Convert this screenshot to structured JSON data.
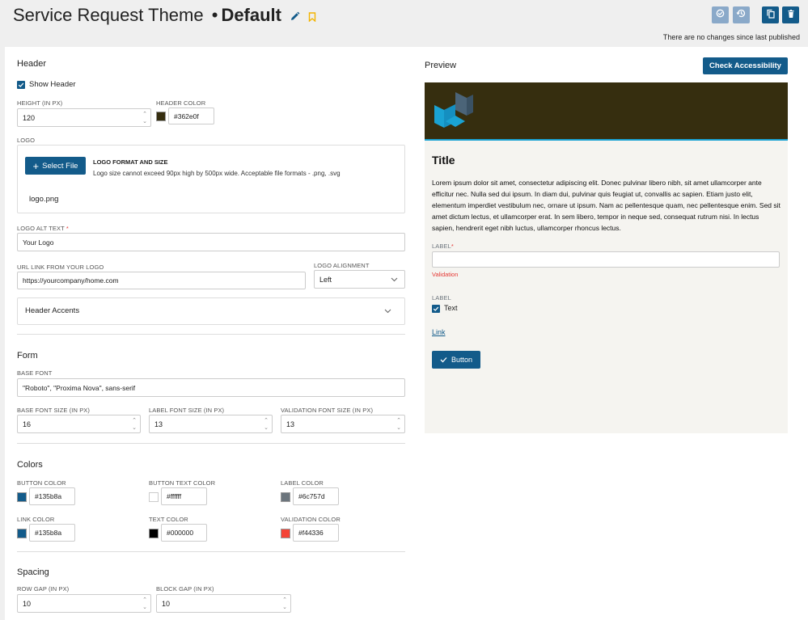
{
  "page": {
    "title_prefix": "Service Request Theme",
    "title_dot": "•",
    "title_name": "Default",
    "status": "There are no changes since last published"
  },
  "header": {
    "section_title": "Header",
    "show_header_label": "Show Header",
    "show_header_checked": true,
    "height_label": "HEIGHT (IN PX)",
    "height_value": "120",
    "header_color_label": "HEADER COLOR",
    "header_color_value": "#362e0f",
    "logo_label": "LOGO",
    "select_file_label": "Select File",
    "logo_format_title": "LOGO FORMAT AND SIZE",
    "logo_format_desc": "Logo size cannot exceed 90px high by 500px wide. Acceptable file formats - .png, .svg",
    "logo_filename": "logo.png",
    "logo_alt_label": "LOGO ALT TEXT",
    "logo_alt_required": "*",
    "logo_alt_value": "Your Logo",
    "url_label": "URL LINK FROM YOUR LOGO",
    "url_value": "https://yourcompany/home.com",
    "alignment_label": "LOGO ALIGNMENT",
    "alignment_value": "Left",
    "accents_label": "Header Accents"
  },
  "form": {
    "section_title": "Form",
    "base_font_label": "BASE FONT",
    "base_font_value": "\"Roboto\", \"Proxima Nova\", sans-serif",
    "base_size_label": "BASE FONT SIZE (IN PX)",
    "base_size_value": "16",
    "label_size_label": "LABEL FONT SIZE (IN PX)",
    "label_size_value": "13",
    "validation_size_label": "VALIDATION FONT SIZE (IN PX)",
    "validation_size_value": "13"
  },
  "colors": {
    "section_title": "Colors",
    "button_color_label": "BUTTON COLOR",
    "button_color_value": "#135b8a",
    "button_text_color_label": "BUTTON TEXT COLOR",
    "button_text_color_value": "#ffffff",
    "label_color_label": "LABEL COLOR",
    "label_color_value": "#6c757d",
    "link_color_label": "LINK COLOR",
    "link_color_value": "#135b8a",
    "text_color_label": "TEXT COLOR",
    "text_color_value": "#000000",
    "validation_color_label": "VALIDATION COLOR",
    "validation_color_value": "#f44336"
  },
  "spacing": {
    "section_title": "Spacing",
    "row_gap_label": "ROW GAP (IN PX)",
    "row_gap_value": "10",
    "block_gap_label": "BLOCK GAP (IN PX)",
    "block_gap_value": "10"
  },
  "preview": {
    "title": "Preview",
    "check_button": "Check Accessibility",
    "heading": "Title",
    "body": "Lorem ipsum dolor sit amet, consectetur adipiscing elit. Donec pulvinar libero nibh, sit amet ullamcorper ante efficitur nec. Nulla sed dui ipsum. In diam dui, pulvinar quis feugiat ut, convallis ac sapien. Etiam justo elit, elementum imperdiet vestibulum nec, ornare ut ipsum. Nam ac pellentesque quam, nec pellentesque enim. Sed sit amet dictum lectus, et ullamcorper erat. In sem libero, tempor in neque sed, consequat rutrum nisi. In lectus sapien, hendrerit eget nibh luctus, ullamcorper rhoncus lectus.",
    "label_required": "LABEL",
    "required_mark": "*",
    "validation_text": "Validation",
    "label_checkbox": "LABEL",
    "checkbox_text": "Text",
    "link_text": "Link",
    "button_text": "Button"
  }
}
